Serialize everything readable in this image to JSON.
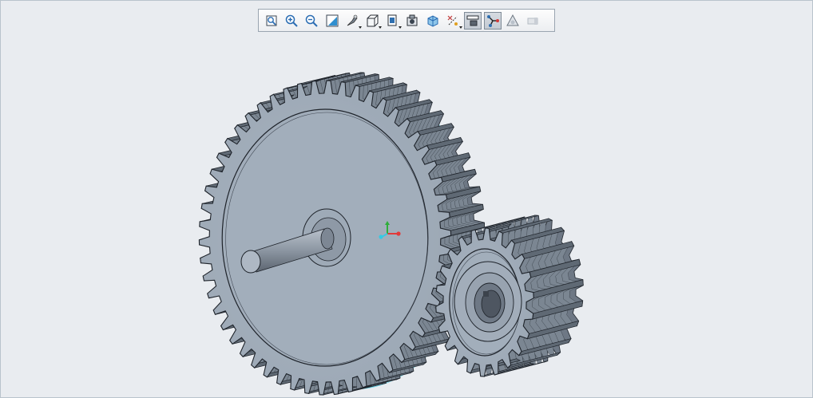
{
  "colors": {
    "background": "#e9ecf0",
    "part_face": "#a5b0bd",
    "part_dark": "#6e7885",
    "edge": "#1e232a",
    "highlight": "#36c9e3",
    "triad_x": "#e23a3a",
    "triad_y": "#2fae3a",
    "triad_z": "#36c9e3"
  },
  "toolbar": {
    "buttons": [
      {
        "name": "refit-button",
        "icon": "refit-icon",
        "pressed": false,
        "flyout": false
      },
      {
        "name": "zoom-in-button",
        "icon": "zoom-in-icon",
        "pressed": false,
        "flyout": false
      },
      {
        "name": "zoom-out-button",
        "icon": "zoom-out-icon",
        "pressed": false,
        "flyout": false
      },
      {
        "name": "repaint-button",
        "icon": "repaint-icon",
        "pressed": false,
        "flyout": false
      },
      {
        "name": "display-style-button",
        "icon": "display-style-icon",
        "pressed": false,
        "flyout": true
      },
      {
        "name": "saved-orientations-button",
        "icon": "saved-orientations-icon",
        "pressed": false,
        "flyout": true
      },
      {
        "name": "view-manager-button",
        "icon": "view-manager-icon",
        "pressed": false,
        "flyout": true
      },
      {
        "name": "perspective-view-button",
        "icon": "perspective-icon",
        "pressed": false,
        "flyout": false
      },
      {
        "name": "section-button",
        "icon": "section-icon",
        "pressed": false,
        "flyout": false
      },
      {
        "name": "datum-display-filters-button",
        "icon": "datum-display-icon",
        "pressed": false,
        "flyout": true
      },
      {
        "name": "annotation-display-button",
        "icon": "annotation-display-icon",
        "pressed": true,
        "flyout": false
      },
      {
        "name": "spin-center-button",
        "icon": "spin-center-icon",
        "pressed": true,
        "flyout": false
      },
      {
        "name": "appearance-button",
        "icon": "appearance-icon",
        "pressed": false,
        "flyout": false
      },
      {
        "name": "disabled-extra-button",
        "icon": "disabled-extra-icon",
        "pressed": false,
        "flyout": false
      }
    ]
  },
  "model": {
    "large_gear_teeth": 54,
    "small_gear_teeth": 22
  }
}
